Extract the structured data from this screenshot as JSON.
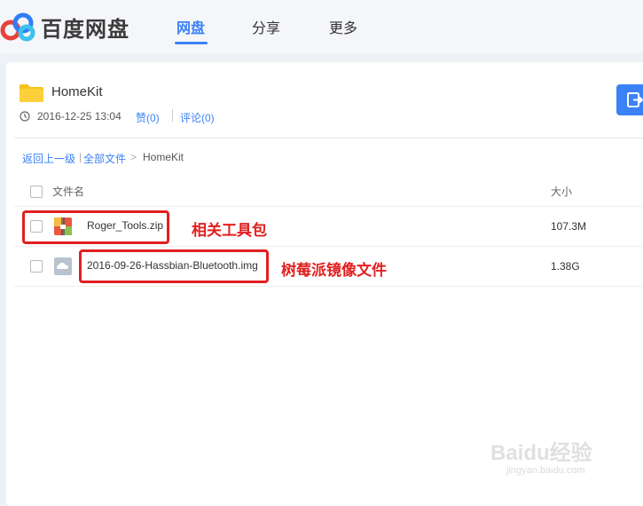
{
  "app": {
    "logo_text": "百度网盘",
    "nav": [
      "网盘",
      "分享",
      "更多"
    ],
    "active_nav": "网盘",
    "accent_color": "#3b82f6"
  },
  "folder": {
    "name": "HomeKit",
    "date": "2016-12-25 13:04",
    "like": "赞(0)",
    "comment": "评论(0)"
  },
  "breadcrumb": {
    "back": "返回上一级",
    "separator": "|",
    "all_files": "全部文件",
    "arrow": ">",
    "current": "HomeKit"
  },
  "table": {
    "columns": {
      "name": "文件名",
      "size": "大小"
    },
    "rows": [
      {
        "name": "Roger_Tools.zip",
        "size": "107.3M",
        "icon": "zip-archive-icon",
        "annotation": "相关工具包"
      },
      {
        "name": "2016-09-26-Hassbian-Bluetooth.img",
        "size": "1.38G",
        "icon": "cloud-file-icon",
        "annotation": "树莓派镜像文件"
      }
    ]
  },
  "watermark": {
    "main": "Baidu经验",
    "sub": "jingyan.baidu.com"
  },
  "colors": {
    "highlight": "#e02020",
    "folder": "#f8c21d"
  }
}
